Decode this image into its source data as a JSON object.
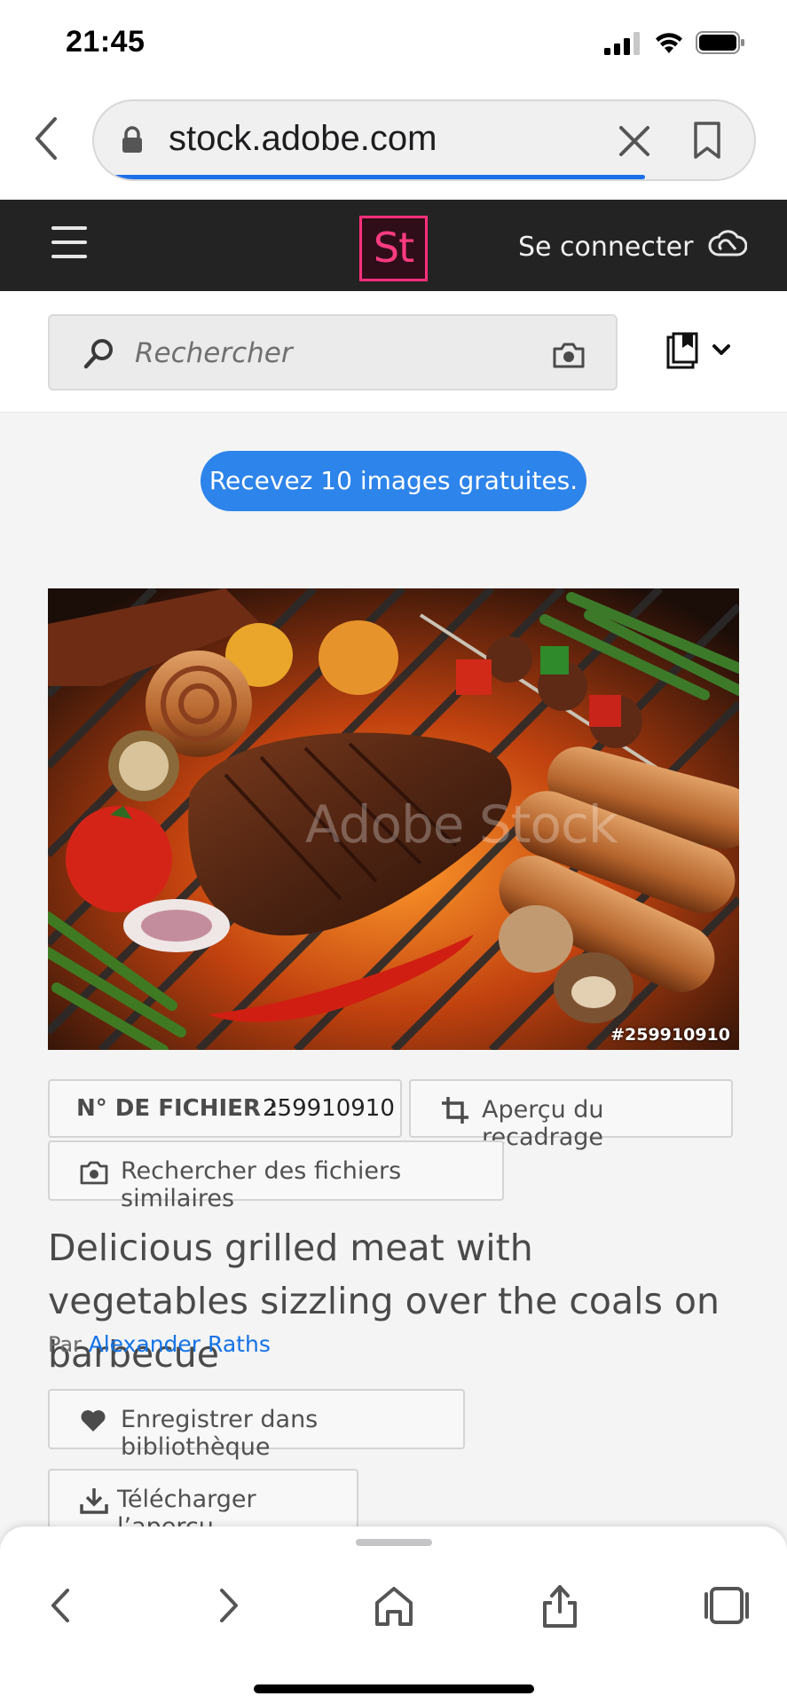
{
  "status": {
    "time": "21:45"
  },
  "browser": {
    "url": "stock.adobe.com",
    "load_progress": 0.82,
    "icons": [
      "back-chevron-icon",
      "lock-icon",
      "close-icon",
      "bookmark-icon"
    ]
  },
  "header": {
    "logo": "St",
    "signin_label": "Se connecter",
    "icons": [
      "menu-icon",
      "creative-cloud-icon"
    ],
    "colors": {
      "bar": "#232323",
      "logo_bg": "#2f0e19",
      "logo_accent": "#ff2f7a"
    }
  },
  "search": {
    "placeholder": "Rechercher",
    "icons": [
      "search-icon",
      "camera-icon",
      "library-icon",
      "chevron-down-icon"
    ]
  },
  "promo": {
    "label": "Recevez 10 images gratuites.",
    "color": "#2d84ea"
  },
  "photo": {
    "watermark": "Adobe Stock",
    "id_overlay": "#259910910"
  },
  "file_info": {
    "label": "N° DE FICHIER :",
    "number": "259910910",
    "crop_preview_label": "Aperçu du recadrage",
    "similar_label": "Rechercher des fichiers similaires"
  },
  "asset": {
    "title": "Delicious grilled meat with vegetables sizzling over the coals on barbecue",
    "by_prefix": "Par",
    "author": "Alexander Raths",
    "author_color": "#1473e6"
  },
  "actions": {
    "save_label": "Enregistrer dans bibliothèque",
    "download_label": "Télécharger l’aperçu"
  },
  "toolbar": {
    "icons": [
      "back-icon",
      "forward-icon",
      "home-icon",
      "share-icon",
      "tabs-icon"
    ]
  }
}
